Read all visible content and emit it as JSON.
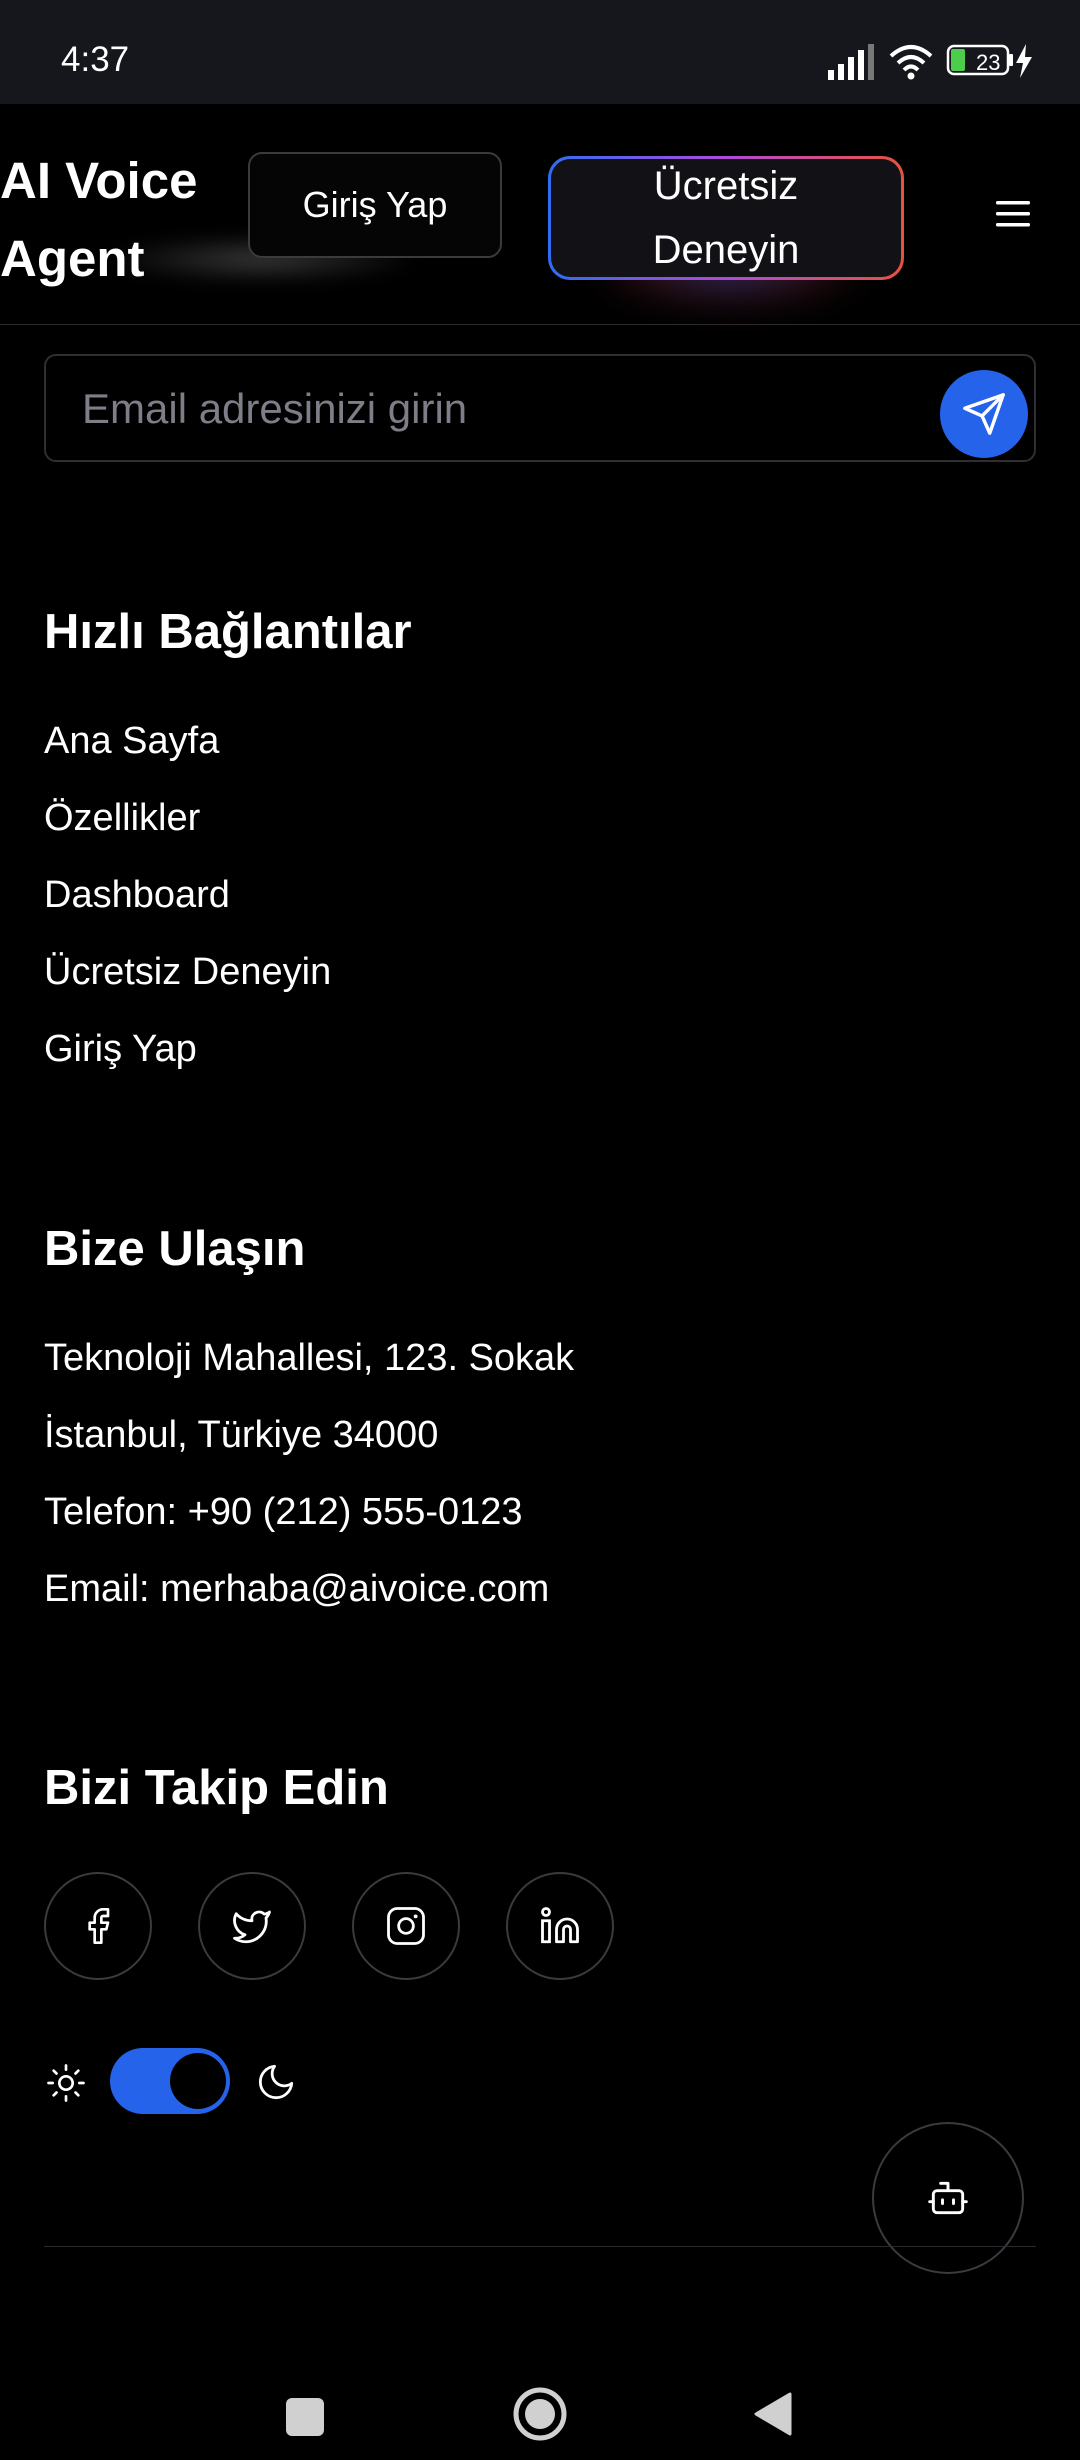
{
  "status_bar": {
    "time": "4:37",
    "battery": "23"
  },
  "header": {
    "brand": "AI Voice Agent",
    "login_label": "Giriş Yap",
    "trial_label": "Ücretsiz Deneyin"
  },
  "newsletter": {
    "placeholder": "Email adresinizi girin"
  },
  "quick_links": {
    "title": "Hızlı Bağlantılar",
    "items": [
      {
        "label": "Ana Sayfa"
      },
      {
        "label": "Özellikler"
      },
      {
        "label": "Dashboard"
      },
      {
        "label": "Ücretsiz Deneyin"
      },
      {
        "label": "Giriş Yap"
      }
    ]
  },
  "contact": {
    "title": "Bize Ulaşın",
    "lines": [
      "Teknoloji Mahallesi, 123. Sokak",
      "İstanbul, Türkiye 34000",
      "Telefon: +90 (212) 555-0123",
      "Email: merhaba@aivoice.com"
    ]
  },
  "social": {
    "title": "Bizi Takip Edin",
    "icons": [
      "facebook-icon",
      "twitter-icon",
      "instagram-icon",
      "linkedin-icon"
    ]
  },
  "theme_toggle": {
    "dark_mode": true
  },
  "colors": {
    "accent": "#2563eb",
    "background": "#000000",
    "status_bar": "#16171c"
  }
}
